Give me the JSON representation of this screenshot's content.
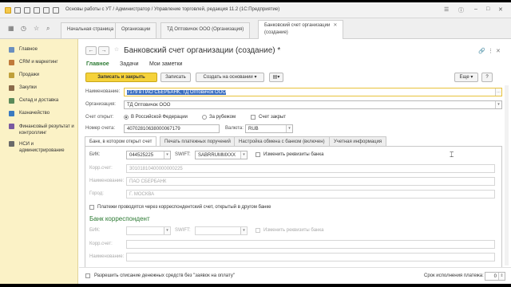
{
  "window": {
    "title": "Основы работы с УТ / Администратор / Управление торговлей, редакция 11.2  (1С:Предприятие)"
  },
  "tabs": [
    {
      "label": "Начальная страница"
    },
    {
      "label": "Организации"
    },
    {
      "label": "ТД Оптовичок ООО (Организация)"
    },
    {
      "label_line1": "Банковский счет организации",
      "label_line2": "(создание)"
    }
  ],
  "sidebar": {
    "items": [
      {
        "label": "Главное",
        "color": "#6a8fbf"
      },
      {
        "label": "CRM и маркетинг",
        "color": "#c07a3a"
      },
      {
        "label": "Продажи",
        "color": "#c0a03a"
      },
      {
        "label": "Закупки",
        "color": "#8a6a4a"
      },
      {
        "label": "Склад и доставка",
        "color": "#5a8a5a"
      },
      {
        "label": "Казначейство",
        "color": "#3a7ac0"
      },
      {
        "label_line1": "Финансовый результат и",
        "label_line2": "контроллинг",
        "color": "#7a5aa0"
      },
      {
        "label_line1": "НСИ и",
        "label_line2": "администрирование",
        "color": "#6a6a6a"
      }
    ]
  },
  "form": {
    "title": "Банковский счет организации (создание) *",
    "subtabs": [
      "Главное",
      "Задачи",
      "Мои заметки"
    ],
    "buttons": {
      "save_close": "Записать и закрыть",
      "save": "Записать",
      "create_basis": "Создать на основании",
      "more": "Еще",
      "help": "?"
    },
    "name": {
      "label": "Наименование:",
      "value": "7179 в ПАО СБЕРБАНК, ТД Оптовичок ООО"
    },
    "org": {
      "label": "Организация:",
      "value": "ТД Оптовичок ООО"
    },
    "account_opened": {
      "label": "Счет открыт:",
      "opt1": "В Российской Федерации",
      "opt2": "За рубежом",
      "closed": "Счет закрыт"
    },
    "account_number": {
      "label": "Номер счета:",
      "value": "40702810638000067179"
    },
    "currency": {
      "label": "Валюта:",
      "value": "RUB"
    },
    "panel_tabs": [
      "Банк, в котором открыт счет",
      "Печать платежных поручений",
      "Настройка обмена с банком (включен)",
      "Учетная информация"
    ],
    "bank": {
      "bik_label": "БИК:",
      "bik": "044525225",
      "swift_label": "SWIFT:",
      "swift": "SABRRUMMXXX",
      "change": "Изменить реквизиты банка",
      "corr_label": "Корр.счет:",
      "corr": "30101810400000000225",
      "name_label": "Наименование:",
      "name": "ПАО СБЕРБАНК",
      "city_label": "Город:",
      "city": "Г. МОСКВА",
      "via_corr": "Платежи проводятся через корреспондентский счет, открытый в другом банке"
    },
    "corr_bank": {
      "title": "Банк корреспондент",
      "bik_label": "БИК:",
      "swift_label": "SWIFT:",
      "change": "Изменить реквизиты банка",
      "corr_label": "Корр.счет:",
      "name_label": "Наименование:"
    },
    "footer": {
      "allow": "Разрешить списание денежных средств без \"заявок на оплату\"",
      "term_label": "Срок исполнения платежа:",
      "term_value": "0"
    }
  }
}
